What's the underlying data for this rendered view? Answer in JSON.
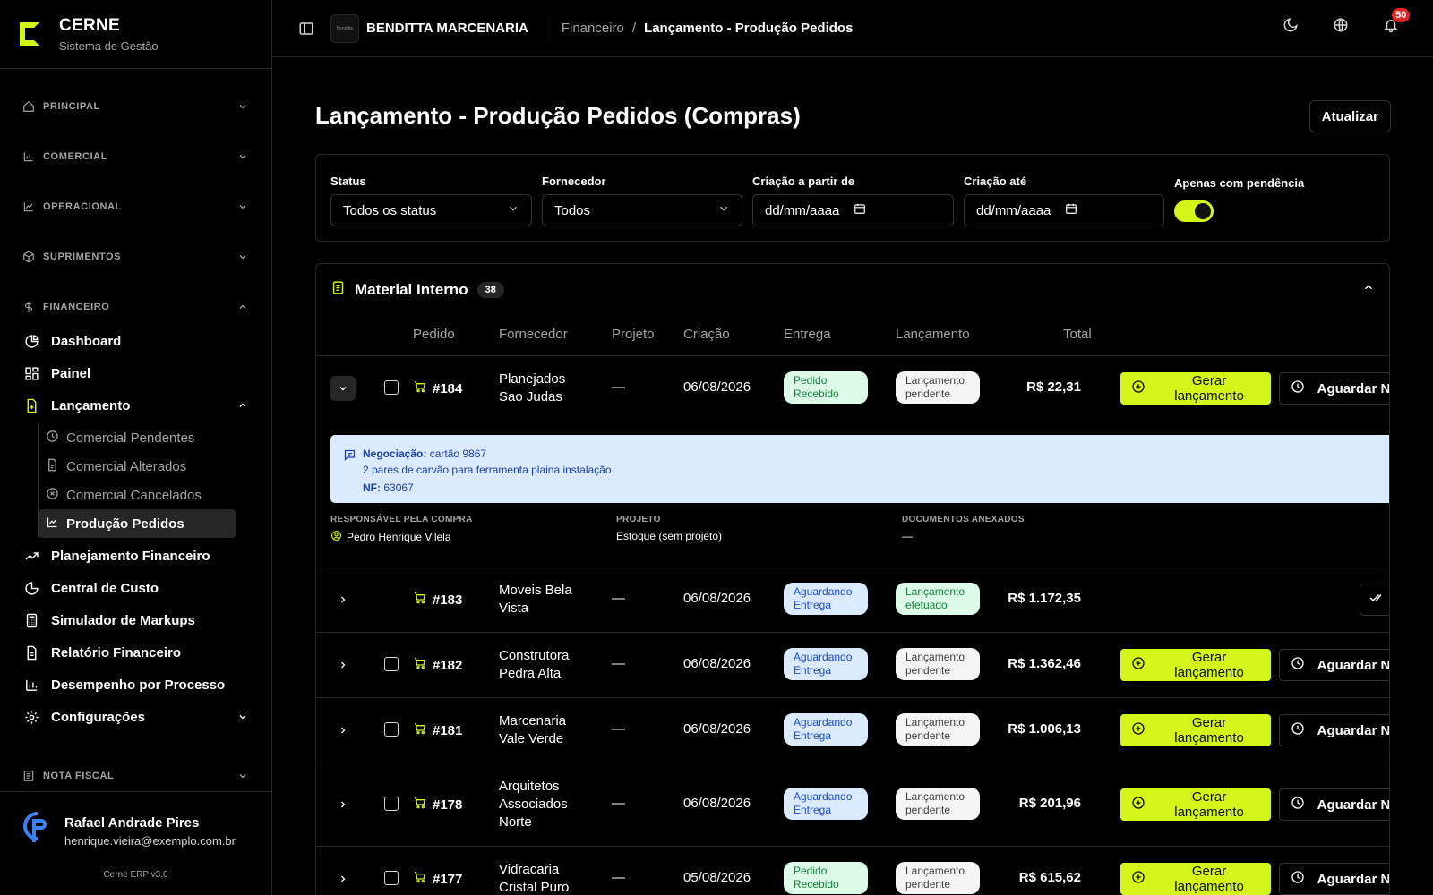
{
  "brand": {
    "name": "CERNE",
    "subtitle": "Sistema de Gestão"
  },
  "sidebar": {
    "groups": [
      {
        "label": "PRINCIPAL"
      },
      {
        "label": "COMERCIAL"
      },
      {
        "label": "OPERACIONAL"
      },
      {
        "label": "SUPRIMENTOS"
      },
      {
        "label": "FINANCEIRO"
      },
      {
        "label": "NOTA FISCAL"
      }
    ],
    "items": [
      {
        "label": "Dashboard"
      },
      {
        "label": "Painel"
      },
      {
        "label": "Lançamento"
      },
      {
        "label": "Planejamento Financeiro"
      },
      {
        "label": "Central de Custo"
      },
      {
        "label": "Simulador de Markups"
      },
      {
        "label": "Relatório Financeiro"
      },
      {
        "label": "Desempenho por Processo"
      },
      {
        "label": "Configurações"
      }
    ],
    "subitems": [
      {
        "label": "Comercial Pendentes"
      },
      {
        "label": "Comercial Alterados"
      },
      {
        "label": "Comercial Cancelados"
      },
      {
        "label": "Produção Pedidos"
      }
    ],
    "user": {
      "name": "Rafael Andrade Pires",
      "email": "henrique.vieira@exemplo.com.br"
    },
    "version": "Cerne ERP v3.0"
  },
  "topbar": {
    "company": "BENDITTA MARCENARIA",
    "company_logo_text": "Benditta",
    "breadcrumb": [
      "Financeiro",
      "/",
      "Lançamento - Produção Pedidos"
    ],
    "notifications": "50"
  },
  "page": {
    "title": "Lançamento - Produção Pedidos (Compras)",
    "refresh_label": "Atualizar"
  },
  "filters": {
    "status": {
      "label": "Status",
      "value": "Todos os status"
    },
    "fornecedor": {
      "label": "Fornecedor",
      "value": "Todos"
    },
    "criacao_de": {
      "label": "Criação a partir de",
      "value": "dd/mm/aaaa"
    },
    "criacao_ate": {
      "label": "Criação até",
      "value": "dd/mm/aaaa"
    },
    "pendencia": {
      "label": "Apenas com pendência",
      "on": true
    }
  },
  "section": {
    "title": "Material Interno",
    "count": "38",
    "columns": [
      "Pedido",
      "Fornecedor",
      "Projeto",
      "Criação",
      "Entrega",
      "Lançamento",
      "Total"
    ],
    "actions": {
      "generate": "Gerar lançamento",
      "wait": "Aguardar N"
    },
    "rows": [
      {
        "pedido": "#184",
        "fornecedor_l1": "Planejados",
        "fornecedor_l2": "Sao Judas",
        "fornecedor_l3": "",
        "projeto": "—",
        "criacao": "06/08/2026",
        "entrega_l1": "Pedido",
        "entrega_l2": "Recebido",
        "lanc_l1": "Lançamento",
        "lanc_l2": "pendente",
        "total": "R$ 22,31"
      },
      {
        "pedido": "#183",
        "fornecedor_l1": "Moveis Bela",
        "fornecedor_l2": "Vista",
        "fornecedor_l3": "",
        "projeto": "—",
        "criacao": "06/08/2026",
        "entrega_l1": "Aguardando",
        "entrega_l2": "Entrega",
        "lanc_l1": "Lançamento",
        "lanc_l2": "efetuado",
        "total": "R$ 1.172,35"
      },
      {
        "pedido": "#182",
        "fornecedor_l1": "Construtora",
        "fornecedor_l2": "Pedra Alta",
        "fornecedor_l3": "",
        "projeto": "—",
        "criacao": "06/08/2026",
        "entrega_l1": "Aguardando",
        "entrega_l2": "Entrega",
        "lanc_l1": "Lançamento",
        "lanc_l2": "pendente",
        "total": "R$ 1.362,46"
      },
      {
        "pedido": "#181",
        "fornecedor_l1": "Marcenaria",
        "fornecedor_l2": "Vale Verde",
        "fornecedor_l3": "",
        "projeto": "—",
        "criacao": "06/08/2026",
        "entrega_l1": "Aguardando",
        "entrega_l2": "Entrega",
        "lanc_l1": "Lançamento",
        "lanc_l2": "pendente",
        "total": "R$ 1.006,13"
      },
      {
        "pedido": "#178",
        "fornecedor_l1": "Arquitetos",
        "fornecedor_l2": "Associados",
        "fornecedor_l3": "Norte",
        "projeto": "—",
        "criacao": "06/08/2026",
        "entrega_l1": "Aguardando",
        "entrega_l2": "Entrega",
        "lanc_l1": "Lançamento",
        "lanc_l2": "pendente",
        "total": "R$ 201,96"
      },
      {
        "pedido": "#177",
        "fornecedor_l1": "Vidracaria",
        "fornecedor_l2": "Cristal Puro",
        "fornecedor_l3": "",
        "projeto": "—",
        "criacao": "05/08/2026",
        "entrega_l1": "Pedido",
        "entrega_l2": "Recebido",
        "lanc_l1": "Lançamento",
        "lanc_l2": "pendente",
        "total": "R$ 615,62"
      }
    ],
    "detail": {
      "neg_label": "Negociação:",
      "neg_value": "cartão 9867",
      "neg_desc": "2 pares de carvão para ferramenta plaina instalação",
      "nf_label": "NF:",
      "nf_value": "63067",
      "resp_label": "RESPONSÁVEL PELA COMPRA",
      "resp_value": "Pedro Henrique Vilela",
      "proj_label": "PROJETO",
      "proj_value": "Estoque (sem projeto)",
      "docs_label": "DOCUMENTOS ANEXADOS",
      "docs_value": "—"
    }
  },
  "colors": {
    "accent": "#d4f518",
    "badge_green": "#dcfce7",
    "badge_blue": "#dbeafe",
    "note_bg": "#dbeafe",
    "notify": "#dc2626"
  }
}
